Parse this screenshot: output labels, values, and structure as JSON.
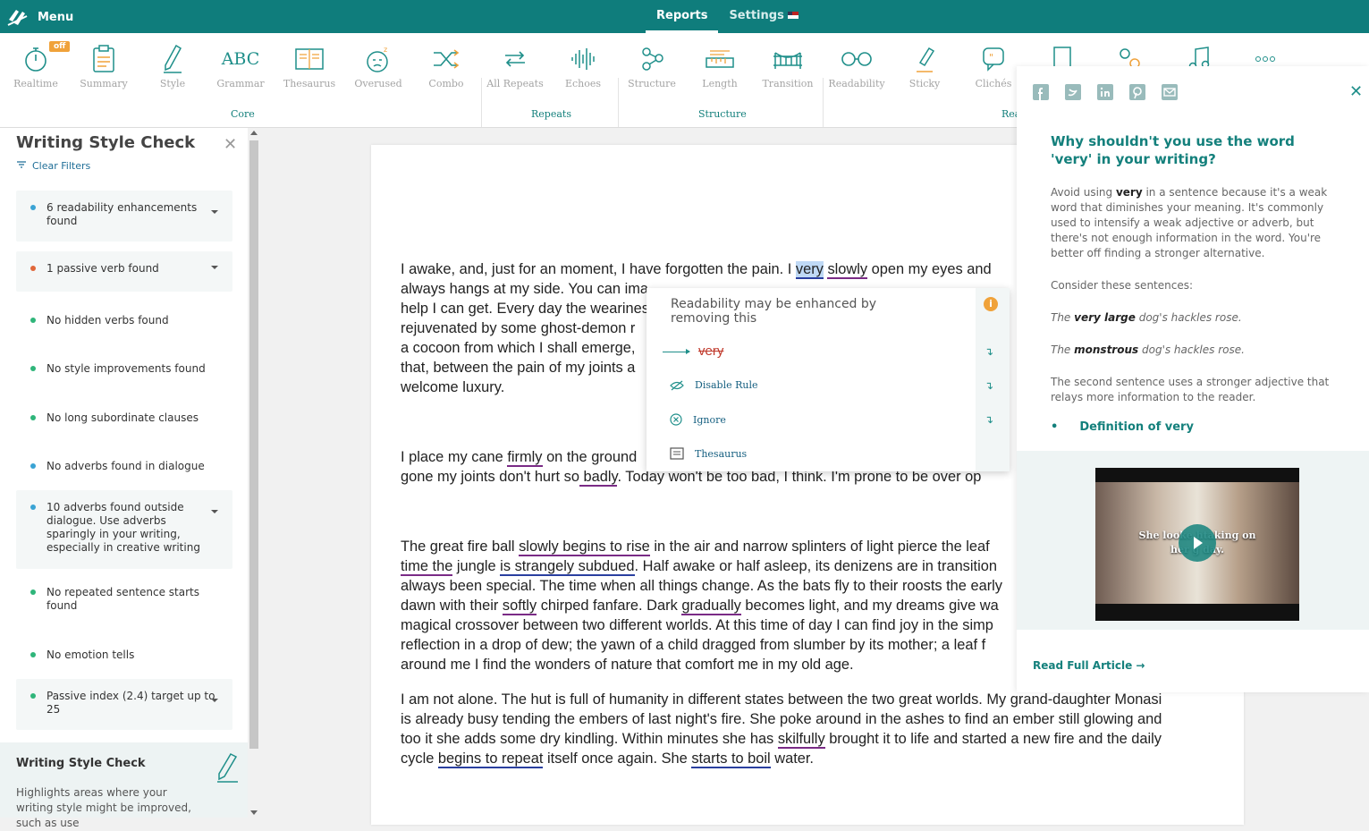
{
  "topbar": {
    "menu_label": "Menu",
    "tabs": [
      {
        "label": "Reports"
      },
      {
        "label": "Settings"
      }
    ]
  },
  "toolbar": {
    "off_badge": "off",
    "tools": [
      {
        "label": "Realtime",
        "icon": "stopwatch-icon"
      },
      {
        "label": "Summary",
        "icon": "clipboard-icon"
      },
      {
        "label": "Style",
        "icon": "pen-icon"
      },
      {
        "label": "Grammar",
        "icon": "abc-icon"
      },
      {
        "label": "Thesaurus",
        "icon": "book-icon"
      },
      {
        "label": "Overused",
        "icon": "tired-face-icon"
      },
      {
        "label": "Combo",
        "icon": "shuffle-icon"
      },
      {
        "label": "All Repeats",
        "icon": "repeat-icon"
      },
      {
        "label": "Echoes",
        "icon": "soundwave-icon"
      },
      {
        "label": "Structure",
        "icon": "nodes-icon"
      },
      {
        "label": "Length",
        "icon": "ruler-icon"
      },
      {
        "label": "Transition",
        "icon": "bridge-icon"
      },
      {
        "label": "Readability",
        "icon": "glasses-icon"
      },
      {
        "label": "Sticky",
        "icon": "glue-icon"
      },
      {
        "label": "Clichés",
        "icon": "quote-bubble-icon"
      }
    ],
    "groups": {
      "core": "Core",
      "repeats": "Repeats",
      "structure": "Structure",
      "rea": "Rea"
    }
  },
  "left_panel": {
    "title": "Writing Style Check",
    "clear_filters": "Clear Filters",
    "items": [
      {
        "text": "6 readability enhancements found",
        "dot": "#3aa3d4"
      },
      {
        "text": "1 passive verb found",
        "dot": "#e0673a"
      },
      {
        "text": "No hidden verbs found",
        "dot": "#2fb57a"
      },
      {
        "text": "No style improvements found",
        "dot": "#2fb57a"
      },
      {
        "text": "No long subordinate clauses",
        "dot": "#2fb57a"
      },
      {
        "text": "No adverbs found in dialogue",
        "dot": "#3aa3d4"
      },
      {
        "text": "10 adverbs found outside dialogue. Use adverbs sparingly in your writing, especially in creative writing",
        "dot": "#3aa3d4"
      },
      {
        "text": "No repeated sentence starts found",
        "dot": "#2fb57a"
      },
      {
        "text": "No emotion tells",
        "dot": "#2fb57a"
      },
      {
        "text": "Passive index (2.4) target up to 25",
        "dot": "#2fb57a"
      }
    ],
    "footer_title": "Writing Style Check",
    "footer_desc": "Highlights areas where your writing style might be improved, such as use"
  },
  "document": {
    "p1": {
      "a": "I awake, and, just for an moment, I have forgotten the pain. I ",
      "very": "very",
      "sp": " ",
      "slowly": "slowly",
      "b": " open my eyes and",
      "l2": "always hangs at my side. You can ima",
      "l3": "help I can get. Every day the weariness",
      "l4": "rejuvenated by some ghost-demon r",
      "l5": "a cocoon from which I shall emerge,",
      "l6": "that, between the pain of my joints a",
      "l7": "welcome luxury."
    },
    "p2": {
      "a": "I place my cane ",
      "firmly": "firmly",
      "b": " on the ground",
      "c": "gone my joints don't hurt so",
      "badly": " badly",
      "d": ". Today won't be too bad, I think. I'm prone to be over op"
    },
    "p3": {
      "a": "The great fire ball ",
      "u1": "slowly begins to rise",
      "b": " in the air and narrow splinters of light pierce the leaf",
      "u2": "time the",
      "c": " jungle ",
      "u3": "is strangely subdued",
      "d": ". Half awake or half asleep, its denizens are in transition",
      "l3": "always been special. The time when all things change. As the bats fly to their roosts the early",
      "e": "dawn with their ",
      "u4": "softly",
      "f": " chirped fanfare. Dark ",
      "u5": "gradually",
      "g": " becomes light, and my dreams give wa",
      "l5": "magical crossover between two different worlds. At this time of day I can find joy in the simp",
      "l6": "reflection in a drop of dew; the yawn of a child dragged from slumber by its mother; a leaf f",
      "l7": "around me I find the wonders of nature that comfort me in my old age."
    },
    "p4": {
      "l1": "I am not alone. The hut is full of humanity in different states between the two great worlds. My grand-daughter Monasi",
      "l2": "is already busy tending the embers of last night's fire. She poke around in the ashes to find an ember still glowing and",
      "a": "too it she adds some dry kindling. Within minutes she has ",
      "u1": "skilfully",
      "b": " brought it to life and started a new fire and the daily",
      "c": "cycle ",
      "u2": "begins to repeat",
      "d": " itself once again. She ",
      "u3": "starts to boil",
      "e": " water."
    }
  },
  "popup": {
    "message": "Readability may be enhanced by removing this",
    "suggestion": "very",
    "info": "i",
    "actions": [
      {
        "label": "Disable Rule",
        "icon": "eye-off-icon"
      },
      {
        "label": "Ignore",
        "icon": "circle-x-icon"
      },
      {
        "label": "Thesaurus",
        "icon": "book-icon"
      }
    ]
  },
  "article": {
    "title": "Why shouldn't you use the word 'very' in your writing?",
    "p1_a": "Avoid using ",
    "p1_b": "very",
    "p1_c": " in a sentence because it's a weak word that diminishes your meaning. It's commonly used to intensify a weak adjective or adverb, but there's not enough information in the word. You're better off finding a stronger alternative.",
    "p2": "Consider these sentences:",
    "ex1_a": "The ",
    "ex1_b": "very large",
    "ex1_c": " dog's hackles rose.",
    "ex2_a": "The ",
    "ex2_b": "monstrous",
    "ex2_c": " dog's hackles rose.",
    "p3": "The second sentence uses a stronger adjective that relays more information to the reader.",
    "definition_link": "Definition of very",
    "video_caption_1": "She looke          htaking on",
    "video_caption_2": "her         g day.",
    "read_full": "Read Full Article →"
  },
  "colors": {
    "brand": "#0f7d7c",
    "accent": "#14807c",
    "badge": "#f0a23a"
  }
}
